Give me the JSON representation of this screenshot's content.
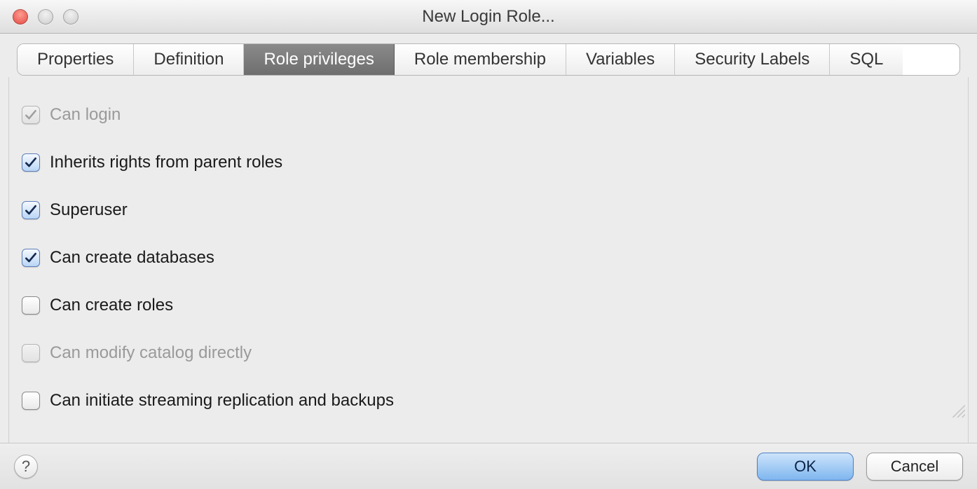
{
  "window": {
    "title": "New Login Role..."
  },
  "tabs": [
    {
      "label": "Properties",
      "selected": false
    },
    {
      "label": "Definition",
      "selected": false
    },
    {
      "label": "Role privileges",
      "selected": true
    },
    {
      "label": "Role membership",
      "selected": false
    },
    {
      "label": "Variables",
      "selected": false
    },
    {
      "label": "Security Labels",
      "selected": false
    },
    {
      "label": "SQL",
      "selected": false
    }
  ],
  "options": [
    {
      "label": "Can login",
      "checked": true,
      "disabled": true
    },
    {
      "label": "Inherits rights from parent roles",
      "checked": true,
      "disabled": false
    },
    {
      "label": "Superuser",
      "checked": true,
      "disabled": false
    },
    {
      "label": "Can create databases",
      "checked": true,
      "disabled": false
    },
    {
      "label": "Can create roles",
      "checked": false,
      "disabled": false
    },
    {
      "label": "Can modify catalog directly",
      "checked": false,
      "disabled": true
    },
    {
      "label": "Can initiate streaming replication and backups",
      "checked": false,
      "disabled": false
    }
  ],
  "buttons": {
    "ok": "OK",
    "cancel": "Cancel",
    "help": "?"
  }
}
